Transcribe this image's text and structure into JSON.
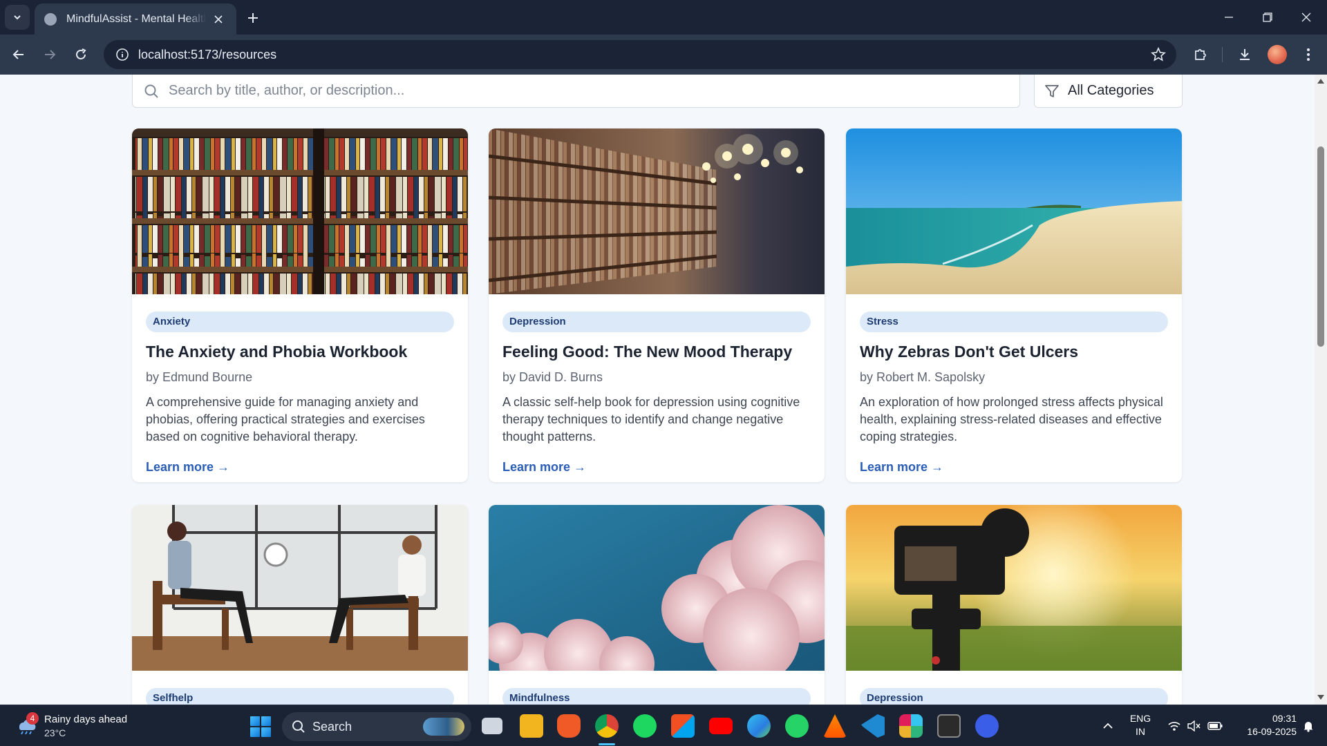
{
  "browser": {
    "tab_title": "MindfulAssist - Mental Health Assistant",
    "url": "localhost:5173/resources"
  },
  "page": {
    "search_placeholder": "Search by title, author, or description...",
    "category_filter": "All Categories",
    "cards": [
      {
        "category": "Anxiety",
        "title": "The Anxiety and Phobia Workbook",
        "author": "by Edmund Bourne",
        "description": "A comprehensive guide for managing anxiety and phobias, offering practical strategies and exercises based on cognitive behavioral therapy.",
        "link": "Learn more →"
      },
      {
        "category": "Depression",
        "title": "Feeling Good: The New Mood Therapy",
        "author": "by David D. Burns",
        "description": "A classic self-help book for depression using cognitive therapy techniques to identify and change negative thought patterns.",
        "link": "Learn more →"
      },
      {
        "category": "Stress",
        "title": "Why Zebras Don't Get Ulcers",
        "author": "by Robert M. Sapolsky",
        "description": "An exploration of how prolonged stress affects physical health, explaining stress-related diseases and effective coping strategies.",
        "link": "Learn more →"
      },
      {
        "category": "Selfhelp"
      },
      {
        "category": "Mindfulness"
      },
      {
        "category": "Depression"
      }
    ]
  },
  "taskbar": {
    "weather_title": "Rainy days ahead",
    "weather_temp": "23°C",
    "weather_badge": "4",
    "search_label": "Search",
    "lang_line1": "ENG",
    "lang_line2": "IN",
    "time": "09:31",
    "date": "16-09-2025"
  },
  "colors": {
    "accent_link": "#2a5db8",
    "badge_bg": "#dce9f8",
    "badge_text": "#1d3c73",
    "chrome_dark": "#1b2436"
  }
}
